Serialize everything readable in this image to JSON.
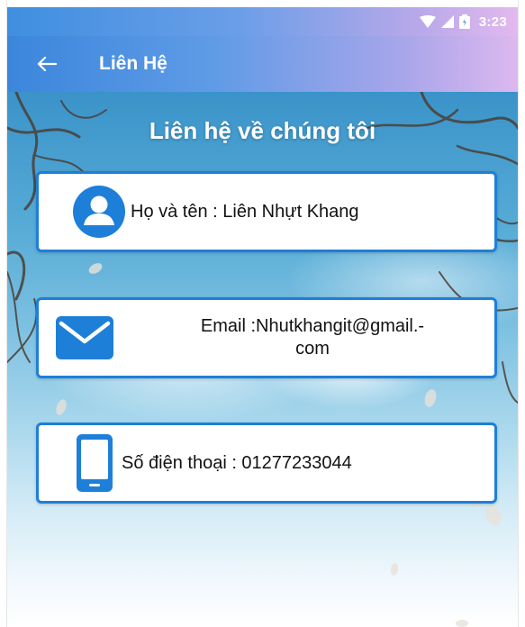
{
  "status_bar": {
    "time": "3:23",
    "icons": [
      "wifi-icon",
      "signal-icon",
      "battery-icon"
    ]
  },
  "app_bar": {
    "title": "Liên Hệ",
    "back_icon": "arrow-left-icon"
  },
  "content": {
    "heading": "Liên hệ về chúng tôi",
    "cards": [
      {
        "icon": "person-icon",
        "text": "Họ và tên : Liên Nhựt Khang"
      },
      {
        "icon": "mail-icon",
        "text_line1": "Email :Nhutkhangit@gmail.-",
        "text_line2": "com"
      },
      {
        "icon": "phone-icon",
        "text": "Số điện thoại : 01277233044"
      }
    ]
  },
  "colors": {
    "accent": "#1e7fd9",
    "appbar_start": "#3b86dc",
    "appbar_end": "#ddb8ef"
  }
}
